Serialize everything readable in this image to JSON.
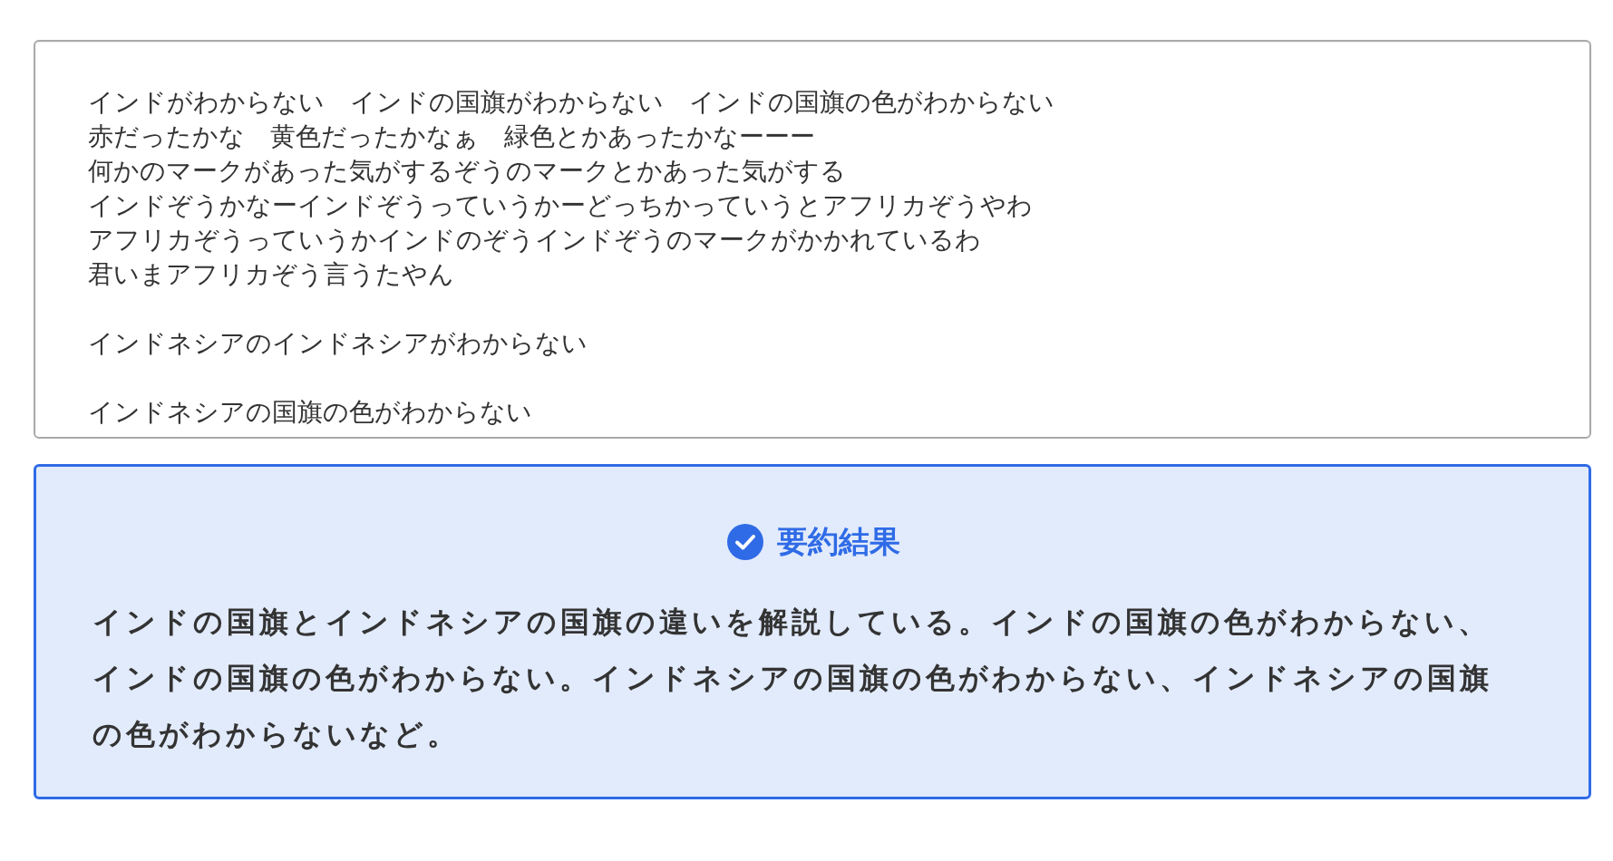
{
  "input": {
    "paragraphs": [
      {
        "lines": [
          "インドがわからない　インドの国旗がわからない　インドの国旗の色がわからない",
          "赤だったかな　黄色だったかなぁ　緑色とかあったかなーーー",
          "何かのマークがあった気がするぞうのマークとかあった気がする",
          "インドぞうかなーインドぞうっていうかーどっちかっていうとアフリカぞうやわ",
          "アフリカぞうっていうかインドのぞうインドぞうのマークがかかれているわ",
          "君いまアフリカぞう言うたやん"
        ]
      },
      {
        "lines": [
          "インドネシアのインドネシアがわからない"
        ]
      },
      {
        "lines": [
          "インドネシアの国旗の色がわからない"
        ]
      }
    ]
  },
  "result": {
    "title": "要約結果",
    "done": true,
    "summary": "インドの国旗とインドネシアの国旗の違いを解説している。インドの国旗の色がわからない、インドの国旗の色がわからない。インドネシアの国旗の色がわからない、インドネシアの国旗の色がわからないなど。"
  }
}
